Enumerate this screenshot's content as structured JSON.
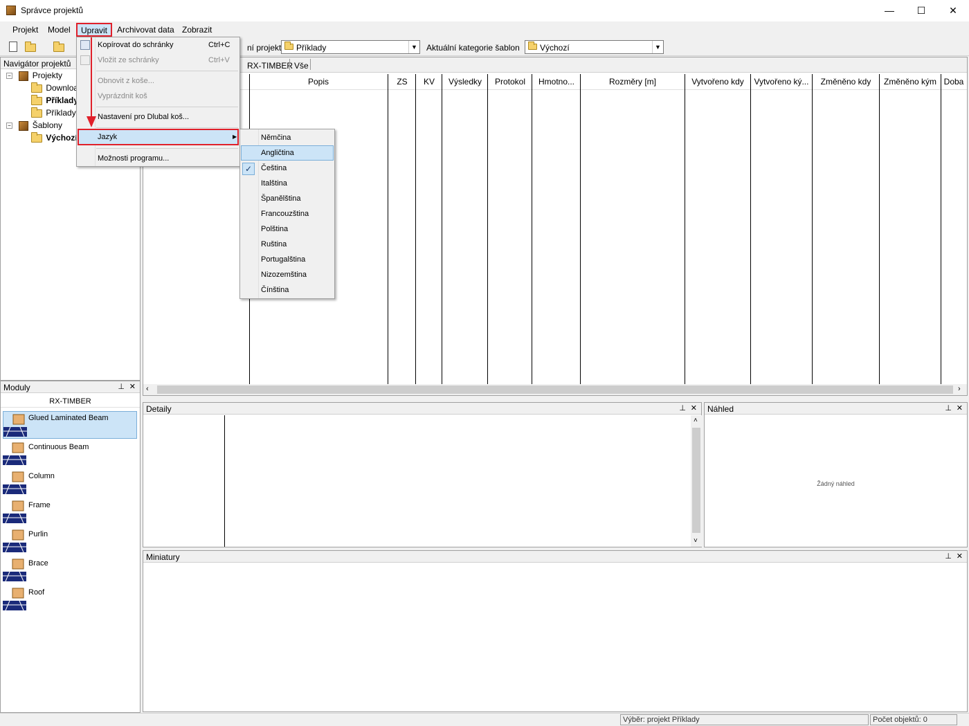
{
  "window": {
    "title": "Správce projektů",
    "minimize": "—",
    "maximize": "☐",
    "close": "✕"
  },
  "menubar": [
    "Projekt",
    "Model",
    "Upravit",
    "Archivovat data",
    "Zobrazit"
  ],
  "toolbar": {
    "project_label": "ní projekt:",
    "project_value": "Příklady",
    "category_label": "Aktuální kategorie šablon",
    "category_value": "Výchozí"
  },
  "navigator": {
    "title": "Navigátor projektů",
    "items": [
      {
        "label": "Projekty",
        "bold": false
      },
      {
        "label": "Downloa",
        "bold": false
      },
      {
        "label": "Příklady",
        "bold": true
      },
      {
        "label": "Příklady I",
        "bold": false
      },
      {
        "label": "Šablony",
        "bold": false
      },
      {
        "label": "Výchozí",
        "bold": true
      }
    ]
  },
  "modules": {
    "title": "Moduly",
    "group": "RX-TIMBER",
    "items": [
      "Glued Laminated Beam",
      "Continuous Beam",
      "Column",
      "Frame",
      "Purlin",
      "Brace",
      "Roof"
    ]
  },
  "tabs": [
    "RX-TIMBER",
    "Vše"
  ],
  "columns": [
    "Popis",
    "ZS",
    "KV",
    "Výsledky",
    "Protokol",
    "Hmotno...",
    "Rozměry [m]",
    "Vytvořeno kdy",
    "Vytvořeno ký...",
    "Změněno kdy",
    "Změněno kým",
    "Doba"
  ],
  "edit_menu": {
    "items": [
      {
        "label": "Kopírovat do schránky",
        "shortcut": "Ctrl+C"
      },
      {
        "label": "Vložit ze schránky",
        "shortcut": "Ctrl+V"
      },
      {
        "label": "Obnovit z koše...",
        "shortcut": ""
      },
      {
        "label": "Vyprázdnit koš",
        "shortcut": ""
      },
      {
        "label": "Nastavení pro Dlubal koš...",
        "shortcut": ""
      },
      {
        "label": "Jazyk",
        "shortcut": ""
      },
      {
        "label": "Možnosti programu...",
        "shortcut": ""
      }
    ]
  },
  "language_menu": {
    "items": [
      "Němčina",
      "Angličtina",
      "Čeština",
      "Italština",
      "Španělština",
      "Francouzština",
      "Polština",
      "Ruština",
      "Portugalština",
      "Nizozemština",
      "Čínština"
    ],
    "highlighted": "Angličtina",
    "checked": "Čeština"
  },
  "panels": {
    "details": "Detaily",
    "preview": "Náhled",
    "preview_empty": "Žádný náhled",
    "thumbnails": "Miniatury"
  },
  "status": {
    "selection": "Výběr: projekt Příklady",
    "count": "Počet objektů: 0"
  },
  "colors": {
    "highlight": "#cce4f7",
    "red_outline": "#e0202a",
    "module_selected": "#cce4f7"
  }
}
